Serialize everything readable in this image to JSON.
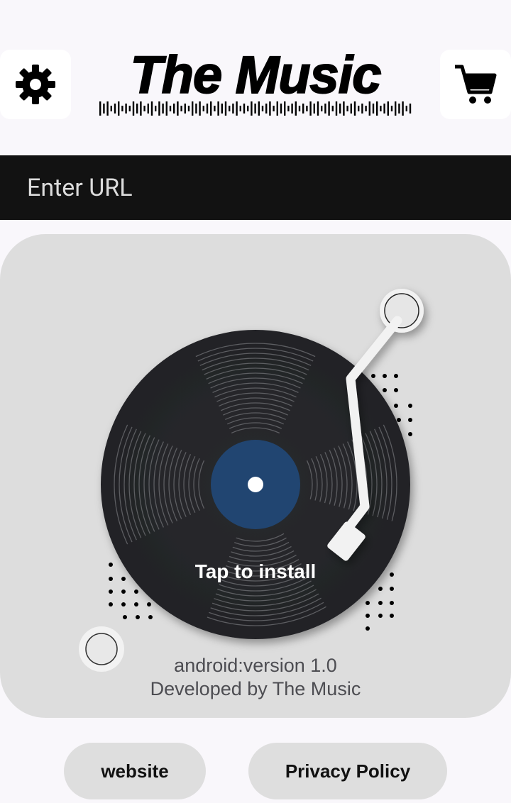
{
  "header": {
    "logo_text": "The Music",
    "settings_icon": "gear-icon",
    "cart_icon": "cart-icon"
  },
  "url_bar": {
    "placeholder": "Enter URL",
    "value": ""
  },
  "player": {
    "install_label": "Tap to install",
    "version_line": "android:version 1.0",
    "developer_line": "Developed by The Music",
    "record_label_color": "#214571",
    "record_color": "#232427"
  },
  "footer": {
    "website_label": "website",
    "privacy_label": "Privacy Policy"
  }
}
